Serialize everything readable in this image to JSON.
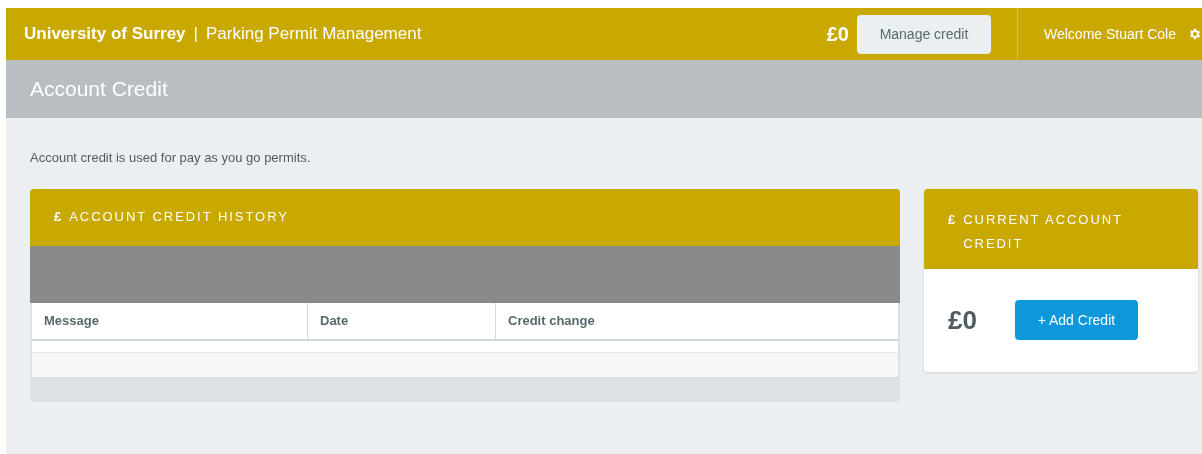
{
  "header": {
    "brand": "University of Surrey",
    "separator": "|",
    "app_name": "Parking Permit Management",
    "balance": "£0",
    "manage_button": "Manage credit",
    "welcome": "Welcome Stuart Cole"
  },
  "page_title": "Account Credit",
  "intro": "Account credit is used for pay as you go permits.",
  "history_panel": {
    "icon": "£",
    "title": "ACCOUNT CREDIT HISTORY",
    "columns": [
      "Message",
      "Date",
      "Credit change"
    ]
  },
  "credit_panel": {
    "icon": "£",
    "title": "CURRENT ACCOUNT CREDIT",
    "amount": "£0",
    "add_button": "+ Add Credit"
  }
}
